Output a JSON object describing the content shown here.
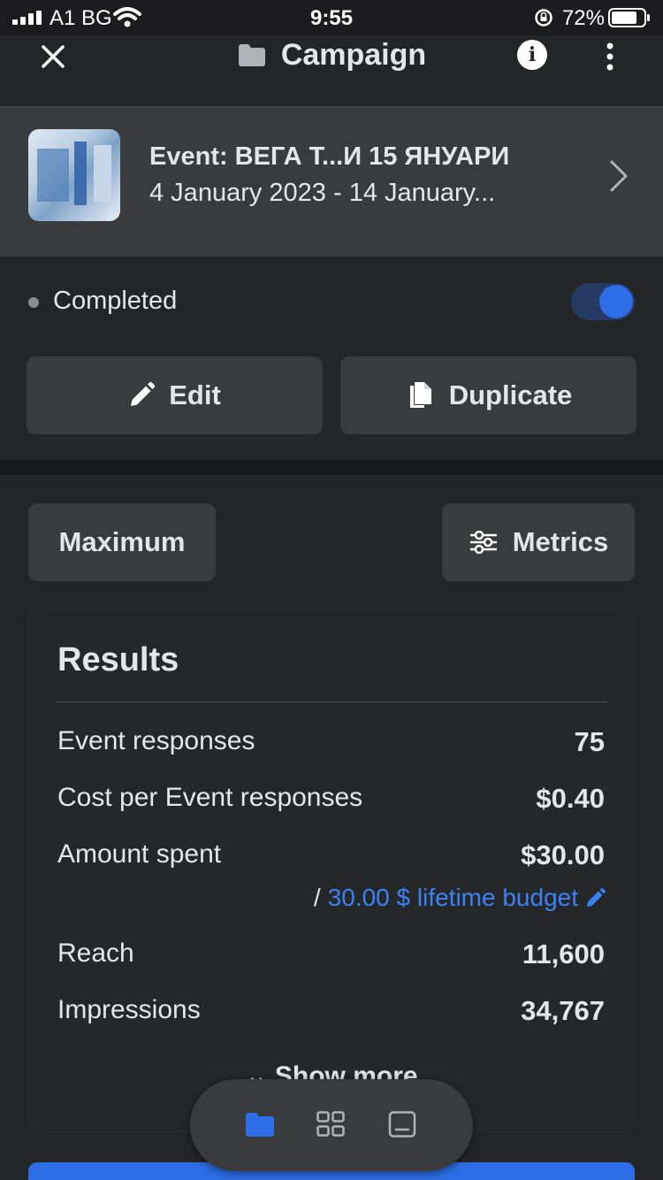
{
  "status_bar": {
    "carrier": "A1 BG",
    "time": "9:55",
    "battery_percent": "72%",
    "icons": [
      "signal-icon",
      "wifi-icon",
      "rotation-lock-icon",
      "battery-icon"
    ]
  },
  "header": {
    "title": "Campaign",
    "icons": [
      "close-icon",
      "folder-icon",
      "info-icon",
      "more-vertical-icon"
    ]
  },
  "event": {
    "title": "Event: ВЕГА Т...И 15 ЯНУАРИ",
    "dates": "4 January 2023 - 14 January..."
  },
  "status": {
    "label": "Completed",
    "toggle_on": true
  },
  "actions": {
    "edit_label": "Edit",
    "duplicate_label": "Duplicate"
  },
  "filters": {
    "maximum_label": "Maximum",
    "metrics_label": "Metrics"
  },
  "results": {
    "title": "Results",
    "rows": [
      {
        "label": "Event responses",
        "value": "75"
      },
      {
        "label": "Cost per Event responses",
        "value": "$0.40"
      },
      {
        "label": "Amount spent",
        "value": "$30.00"
      },
      {
        "label": "Reach",
        "value": "11,600"
      },
      {
        "label": "Impressions",
        "value": "34,767"
      }
    ],
    "budget_slash": "/",
    "budget_text": "30.00 $ lifetime budget",
    "show_more": "Show more"
  },
  "bottom_nav": {
    "items": [
      "folder-icon",
      "grid-icon",
      "tablet-icon"
    ],
    "active_index": 0
  },
  "colors": {
    "accent": "#2d6ee6",
    "link": "#3b82f6",
    "background": "#242526",
    "card": "#3a3b3c"
  }
}
